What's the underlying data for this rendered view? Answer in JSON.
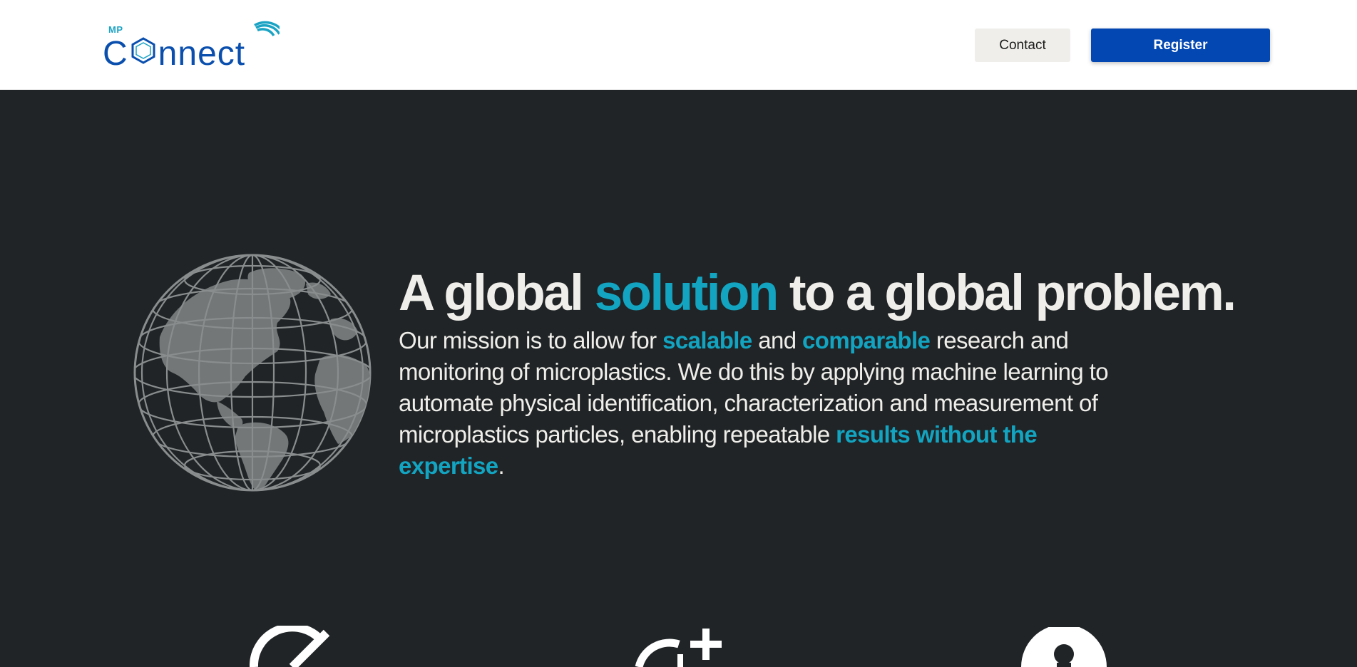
{
  "header": {
    "logo": {
      "small_text": "MP",
      "brand_text": "Connect",
      "icon": "wifi-signal-icon"
    },
    "contact_label": "Contact",
    "register_label": "Register"
  },
  "hero": {
    "globe_icon": "globe-icon",
    "headline": {
      "part1": "A global ",
      "accent": "solution",
      "part2": " to a global problem."
    },
    "mission": {
      "t1": "Our mission is to allow for ",
      "a1": "scalable",
      "t2": " and ",
      "a2": "comparable",
      "t3": " research and monitoring of microplastics. We do this by applying machine learning to automate physical identification, characterization and measurement of microplastics particles, enabling repeatable ",
      "a3": "results without the expertise",
      "t4": "."
    }
  },
  "features": {
    "icons": [
      "measure-icon",
      "add-target-icon",
      "user-icon"
    ]
  },
  "colors": {
    "header_bg": "#ffffff",
    "page_bg": "#202426",
    "accent": "#12a4c1",
    "brand_blue": "#0347b3",
    "text_light": "#efeeea",
    "globe_gray": "#737778"
  }
}
